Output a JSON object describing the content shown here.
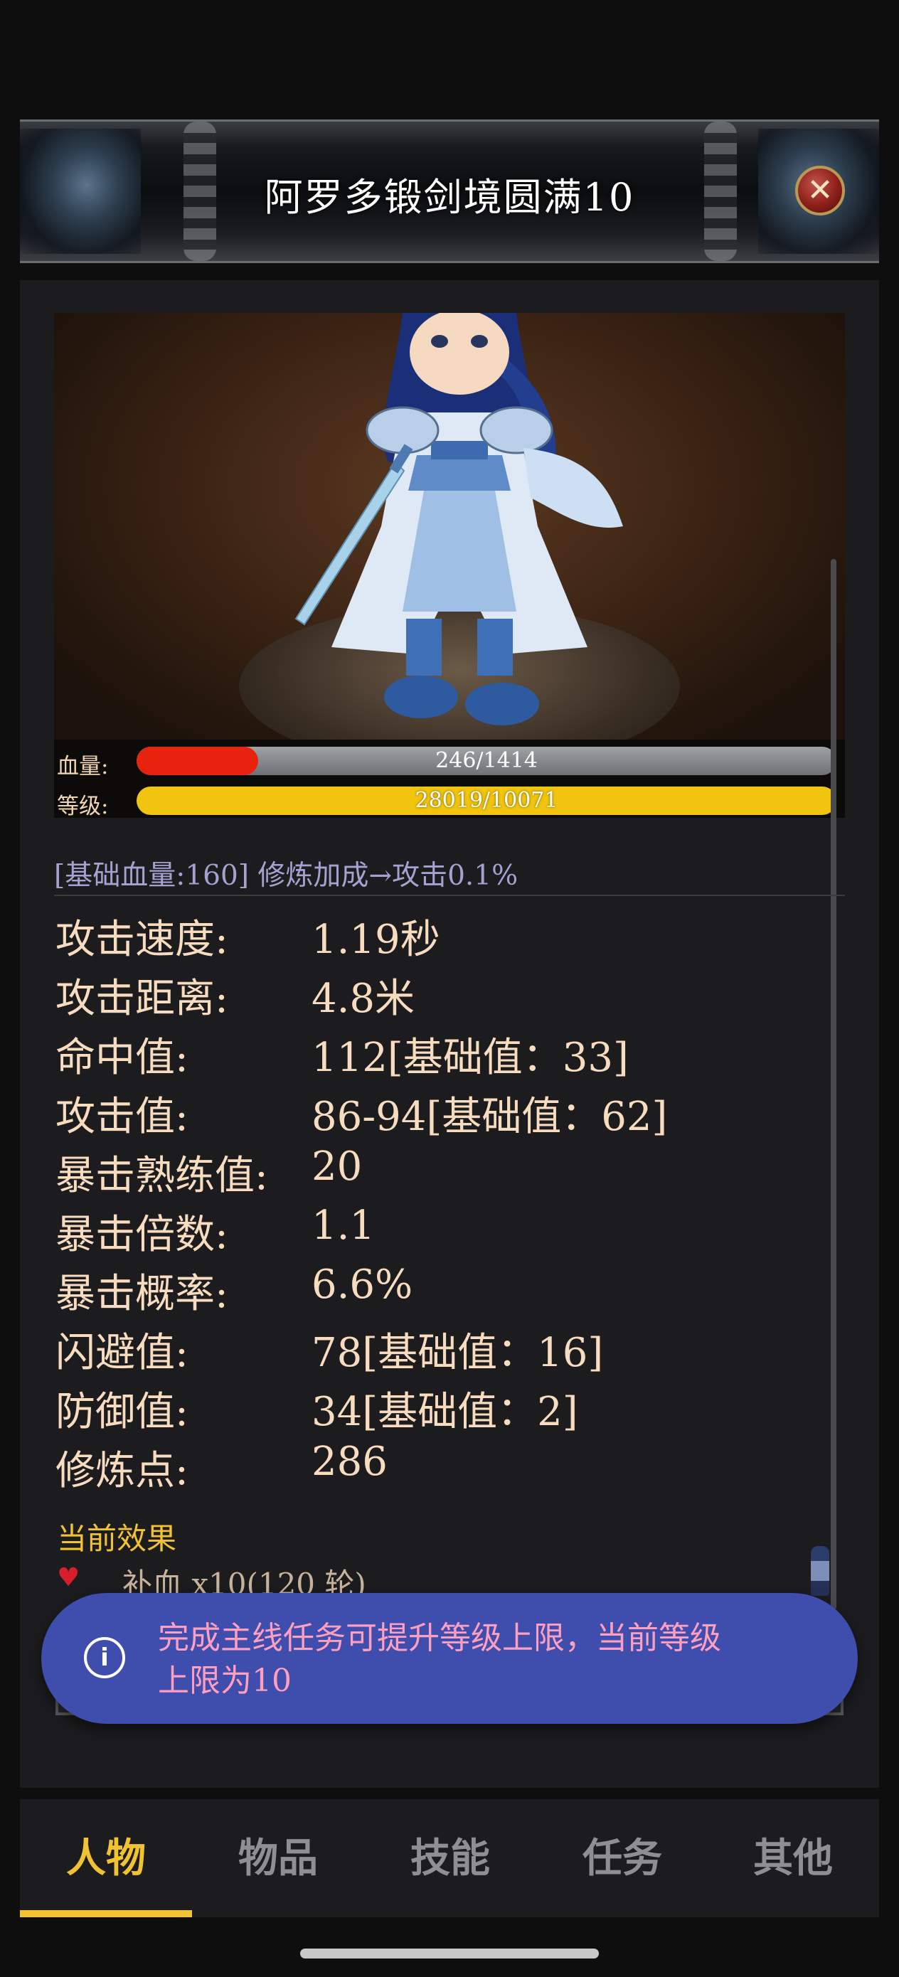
{
  "header": {
    "title": "阿罗多锻剑境圆满10",
    "close_icon": "close-icon"
  },
  "character": {
    "hp_label": "血量:",
    "hp_text": "246/1414",
    "hp_current": 246,
    "hp_max": 1414,
    "level_label": "等级:",
    "level_text": "28019/10071",
    "level_fill_fraction": 1.0
  },
  "hint": "[基础血量:160] 修炼加成→攻击0.1%",
  "stats": [
    {
      "key": "攻击速度:",
      "value": "1.19秒"
    },
    {
      "key": "攻击距离:",
      "value": "4.8米"
    },
    {
      "key": "命中值:",
      "value": "112[基础值：33]"
    },
    {
      "key": "攻击值:",
      "value": "86-94[基础值：62]"
    },
    {
      "key": "暴击熟练值:",
      "value": "20"
    },
    {
      "key": "暴击倍数:",
      "value": "1.1"
    },
    {
      "key": "暴击概率:",
      "value": "6.6%"
    },
    {
      "key": "闪避值:",
      "value": "78[基础值：16]"
    },
    {
      "key": "防御值:",
      "value": "34[基础值：2]"
    },
    {
      "key": "修炼点:",
      "value": "286"
    }
  ],
  "effects": {
    "title": "当前效果",
    "items": [
      {
        "icon": "heart-icon",
        "text": "补血 x10(120 轮)"
      }
    ]
  },
  "toast": {
    "icon": "info-icon",
    "message_line1": "完成主线任务可提升等级上限，当前等级",
    "message_line2": "上限为10"
  },
  "tabs": [
    {
      "label": "人物",
      "active": true
    },
    {
      "label": "物品",
      "active": false
    },
    {
      "label": "技能",
      "active": false
    },
    {
      "label": "任务",
      "active": false
    },
    {
      "label": "其他",
      "active": false
    }
  ],
  "colors": {
    "accent": "#f1c232",
    "hp_fill": "#e8230d",
    "toast_bg": "#3f4dad",
    "toast_text": "#ff9fbf",
    "hint_text": "#a4a2d0"
  }
}
